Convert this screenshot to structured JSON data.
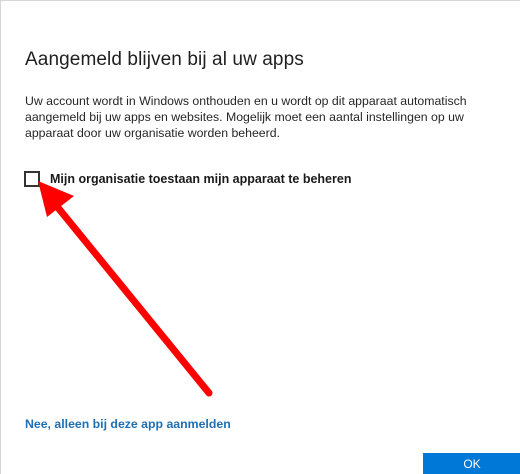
{
  "dialog": {
    "title": "Aangemeld blijven bij al uw apps",
    "description": "Uw account wordt in Windows onthouden en u wordt op dit apparaat automatisch aangemeld bij uw apps en websites. Mogelijk moet een aantal instellingen op uw apparaat door uw organisatie worden beheerd.",
    "checkbox": {
      "label": "Mijn organisatie toestaan mijn apparaat te beheren",
      "checked": false
    },
    "skip_link": "Nee, alleen bij deze app aanmelden",
    "ok_button": "OK"
  },
  "annotation": {
    "type": "arrow",
    "color": "#ff0000",
    "points_to": "checkbox"
  },
  "colors": {
    "accent": "#0078d7",
    "link": "#1f6fb3"
  }
}
